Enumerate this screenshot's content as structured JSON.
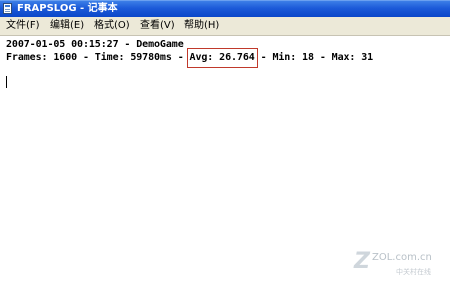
{
  "window": {
    "title": "FRAPSLOG - 记事本",
    "icon": "notepad-icon"
  },
  "menu": {
    "file": "文件(F)",
    "edit": "编辑(E)",
    "format": "格式(O)",
    "view": "查看(V)",
    "help": "帮助(H)"
  },
  "content": {
    "line1": "2007-01-05 00:15:27 - DemoGame",
    "line2_prefix": "Frames: 1600 - Time: 59780ms - ",
    "line2_avg": "Avg: 26.764",
    "line2_suffix": " - Min: 18 - Max: 31"
  },
  "watermark": {
    "logo_letter": "Z",
    "domain": "ZOL.com.cn",
    "subtitle": "中关村在线"
  },
  "colors": {
    "titlebar": "#0a46c9",
    "menubar": "#ece9d8",
    "highlight_box": "#c0392b"
  }
}
